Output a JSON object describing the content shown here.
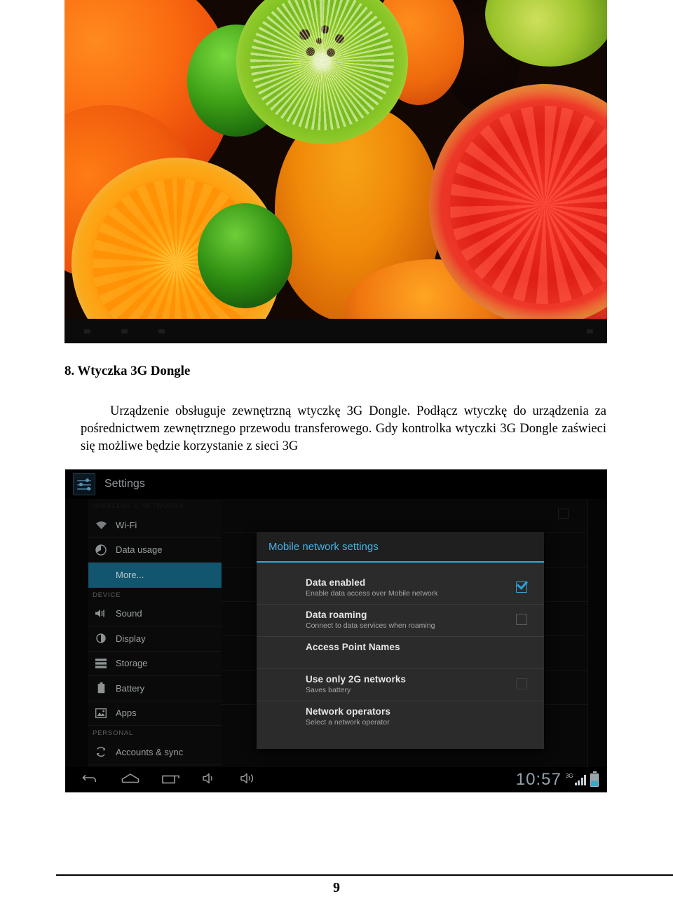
{
  "document": {
    "heading": "8. Wtyczka 3G Dongle",
    "paragraph_line1": "Urządzenie obsługuje zewnętrzną wtyczkę 3G Dongle. Podłącz wtyczkę do urządzenia za pośrednictwem zewnętrznego przewodu transferowego. Gdy kontrolka wtyczki 3G Dongle zaświeci się możliwe będzie korzystanie z sieci 3G",
    "page_number": "9"
  },
  "photo": {
    "alt": "fruit-photo-oranges-kiwi-grapefruit-limes"
  },
  "tablet": {
    "app_title": "Settings",
    "sidebar": {
      "section_wireless": "WIRELESS & NETWORKS",
      "section_device": "DEVICE",
      "section_personal": "PERSONAL",
      "items": [
        {
          "label": "Wi-Fi",
          "icon": "wifi-icon",
          "selected": false
        },
        {
          "label": "Data usage",
          "icon": "data-usage-icon",
          "selected": false
        },
        {
          "label": "More...",
          "icon": "none",
          "selected": true
        },
        {
          "label": "Sound",
          "icon": "sound-icon",
          "selected": false
        },
        {
          "label": "Display",
          "icon": "display-icon",
          "selected": false
        },
        {
          "label": "Storage",
          "icon": "storage-icon",
          "selected": false
        },
        {
          "label": "Battery",
          "icon": "battery-icon",
          "selected": false
        },
        {
          "label": "Apps",
          "icon": "apps-icon",
          "selected": false
        },
        {
          "label": "Accounts & sync",
          "icon": "sync-icon",
          "selected": false
        }
      ]
    },
    "dialog": {
      "title": "Mobile network settings",
      "accent_color": "#3ba2d6",
      "rows": [
        {
          "title": "Data enabled",
          "subtitle": "Enable data access over Mobile network",
          "checkbox": "checked"
        },
        {
          "title": "Data roaming",
          "subtitle": "Connect to data services when roaming",
          "checkbox": "unchecked"
        },
        {
          "title": "Access Point Names",
          "subtitle": "",
          "checkbox": "none"
        },
        {
          "title": "Use only 2G networks",
          "subtitle": "Saves battery",
          "checkbox": "unchecked-dim"
        },
        {
          "title": "Network operators",
          "subtitle": "Select a network operator",
          "checkbox": "none"
        }
      ]
    },
    "systembar": {
      "back": "back-icon",
      "home": "home-icon",
      "recents": "recents-icon",
      "volume_down": "volume-down-icon",
      "volume_up": "volume-up-icon",
      "clock": "10:57",
      "network_type": "3G",
      "signal": "signal-bars-icon",
      "battery": "battery-icon"
    }
  }
}
